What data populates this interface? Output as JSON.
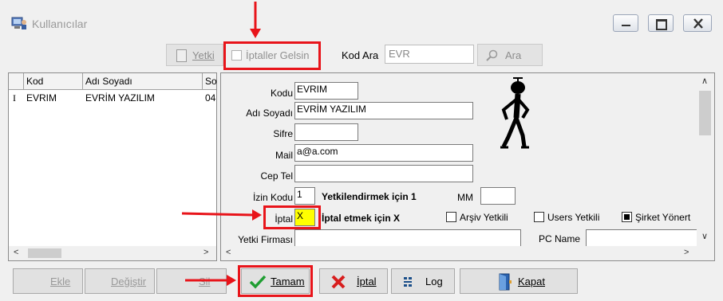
{
  "window": {
    "title": "Kullanıcılar"
  },
  "toolbar": {
    "yetki_label": "Yetki",
    "iptaller_label": "İptaller Gelsin",
    "kod_ara_label": "Kod Ara",
    "search_value": "EVR",
    "ara_label": "Ara"
  },
  "grid": {
    "columns": [
      "Kod",
      "Adı Soyadı",
      "So"
    ],
    "rows": [
      {
        "marker": "I",
        "kod": "EVRIM",
        "adi": "EVRİM YAZILIM",
        "so": "04"
      }
    ]
  },
  "form": {
    "kodu_label": "Kodu",
    "kodu_value": "EVRIM",
    "adi_label": "Adı Soyadı",
    "adi_value": "EVRİM YAZILIM",
    "sifre_label": "Sifre",
    "sifre_value": "",
    "mail_label": "Mail",
    "mail_value": "a@a.com",
    "cep_label": "Cep Tel",
    "cep_value": "",
    "izin_label": "İzin Kodu",
    "izin_value": "1",
    "izin_hint": "Yetkilendirmek için 1",
    "mm_label": "MM",
    "mm_value": "",
    "iptal_label": "İptal",
    "iptal_value": "X",
    "iptal_hint": "İptal etmek için X",
    "arsiv_label": "Arşiv Yetkili",
    "arsiv_checked": false,
    "users_label": "Users Yetkili",
    "users_checked": false,
    "sirket_label": "Şirket Yönert",
    "sirket_checked": true,
    "yetki_firmasi_label": "Yetki Firması",
    "yetki_firmasi_value": "",
    "pc_name_label": "PC Name",
    "pc_name_value": ""
  },
  "buttons": {
    "ekle": "Ekle",
    "degistir": "Değiştir",
    "sil": "Sil",
    "tamam": "Tamam",
    "iptal": "İptal",
    "log": "Log",
    "kapat": "Kapat"
  },
  "colors": {
    "highlight": "#e8141a",
    "iptal_field_bg": "#ffff00"
  }
}
